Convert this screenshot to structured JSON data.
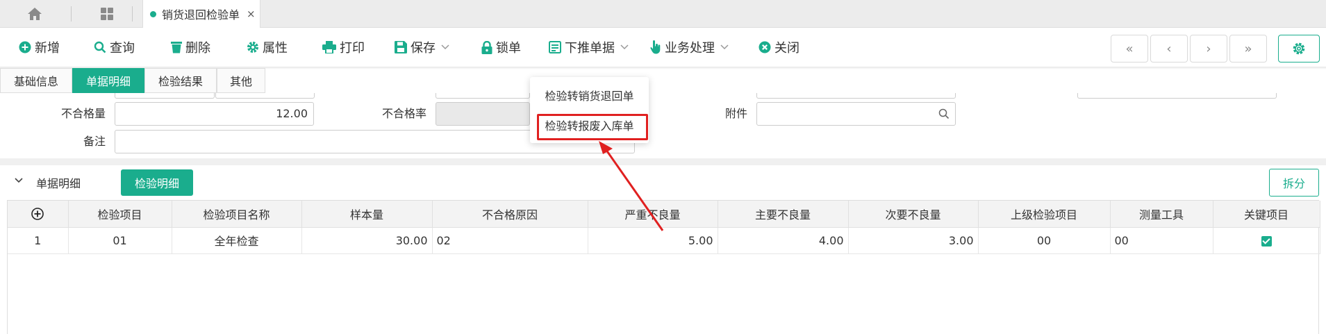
{
  "tabbar": {
    "home_icon": "home-icon",
    "apps_icon": "grid-icon",
    "doc_tab_label": "销货退回检验单",
    "close_glyph": "×"
  },
  "toolbar": {
    "new": "新增",
    "query": "查询",
    "delete": "删除",
    "properties": "属性",
    "print": "打印",
    "save": "保存",
    "lock": "锁单",
    "push_down": "下推单据",
    "business": "业务处理",
    "close": "关闭",
    "nav_first": "«",
    "nav_prev": "‹",
    "nav_next": "›",
    "nav_last": "»"
  },
  "section_tabs": [
    "基础信息",
    "单据明细",
    "检验结果",
    "其他"
  ],
  "form": {
    "unqualified_qty_label": "不合格量",
    "unqualified_qty_value": "12.00",
    "unqualified_rate_label": "不合格率",
    "unqualified_rate_value": "",
    "attachment_label": "附件",
    "attachment_value": "",
    "remark_label": "备注",
    "remark_value": ""
  },
  "dropdown": {
    "items": [
      "检验转销货退回单",
      "检验转报废入库单"
    ],
    "highlighted_index": 1
  },
  "detail": {
    "section_title": "单据明细",
    "inspect_detail_button": "检验明细",
    "split_button": "拆分"
  },
  "grid": {
    "columns": [
      "检验项目",
      "检验项目名称",
      "样本量",
      "不合格原因",
      "严重不良量",
      "主要不良量",
      "次要不良量",
      "上级检验项目",
      "测量工具",
      "关键项目"
    ],
    "rows": [
      {
        "index": "1",
        "item": "01",
        "item_name": "全年检查",
        "sample": "30.00",
        "reason": "02",
        "critical": "5.00",
        "major": "4.00",
        "minor": "3.00",
        "parent": "00",
        "tool": "00",
        "key": true
      }
    ]
  },
  "colors": {
    "accent": "#1aad8d",
    "highlight_border": "#e02020"
  }
}
